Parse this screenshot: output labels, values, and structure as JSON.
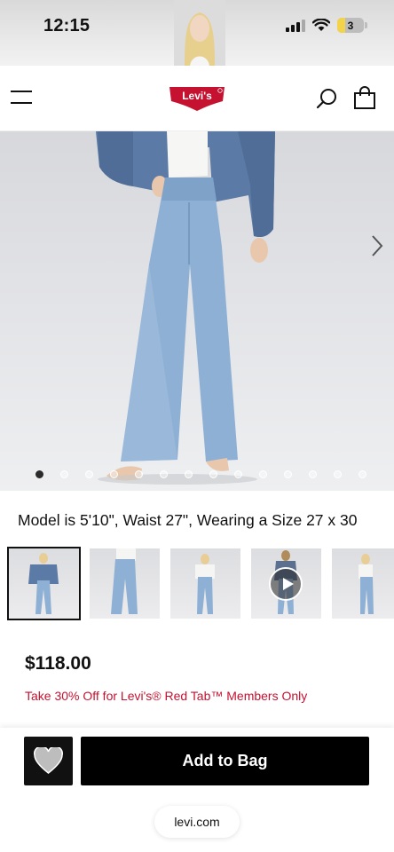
{
  "status_bar": {
    "time": "12:15",
    "battery_level": "3",
    "battery_fraction": 0.3
  },
  "header": {
    "logo_text": "Levi's",
    "logo_color": "#c41230"
  },
  "icons": {
    "menu": "hamburger-menu-icon",
    "search": "search-icon",
    "bag": "shopping-bag-icon",
    "next": "chevron-right-icon",
    "wishlist": "heart-icon",
    "video": "play-icon"
  },
  "gallery": {
    "total_images": 14,
    "active_index": 0
  },
  "product": {
    "model_info": "Model is 5'10\", Waist 27\", Wearing a Size 27 x 30",
    "price": "$118.00",
    "promo": "Take 30% Off for Levi's® Red Tab™ Members Only",
    "promo_color": "#c41230"
  },
  "thumbnails": [
    {
      "view": "front-jacket",
      "selected": true
    },
    {
      "view": "front"
    },
    {
      "view": "front-shirt"
    },
    {
      "view": "video",
      "video": true
    },
    {
      "view": "side"
    }
  ],
  "actions": {
    "add_to_bag": "Add to Bag"
  },
  "browser": {
    "url": "levi.com"
  }
}
